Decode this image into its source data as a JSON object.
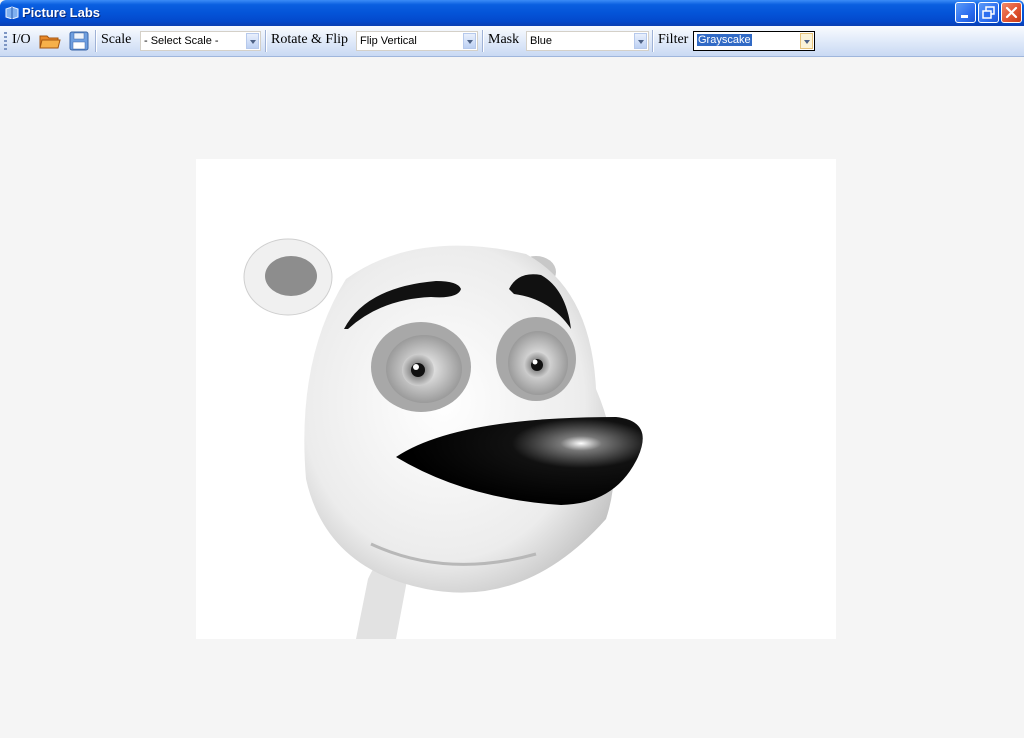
{
  "window": {
    "title": "Picture Labs",
    "icons": {
      "app": "book-icon",
      "minimize": "minimize-icon",
      "restore": "restore-icon",
      "close": "close-icon"
    }
  },
  "toolbar": {
    "io_label": "I/O",
    "open_icon": "folder-open-icon",
    "save_icon": "floppy-disk-icon",
    "scale": {
      "label": "Scale",
      "value": "- Select Scale -"
    },
    "rotate_flip": {
      "label": "Rotate & Flip",
      "value": "Flip Vertical"
    },
    "mask": {
      "label": "Mask",
      "value": "Blue"
    },
    "filter": {
      "label": "Filter",
      "value": "Grayscake"
    }
  },
  "canvas": {
    "image_subject": "cartoon bear face in grayscale"
  },
  "colors": {
    "titlebar": "#0454d8",
    "toolbar": "#dce7f8",
    "workspace": "#f5f5f5",
    "selection": "#316ac5"
  }
}
